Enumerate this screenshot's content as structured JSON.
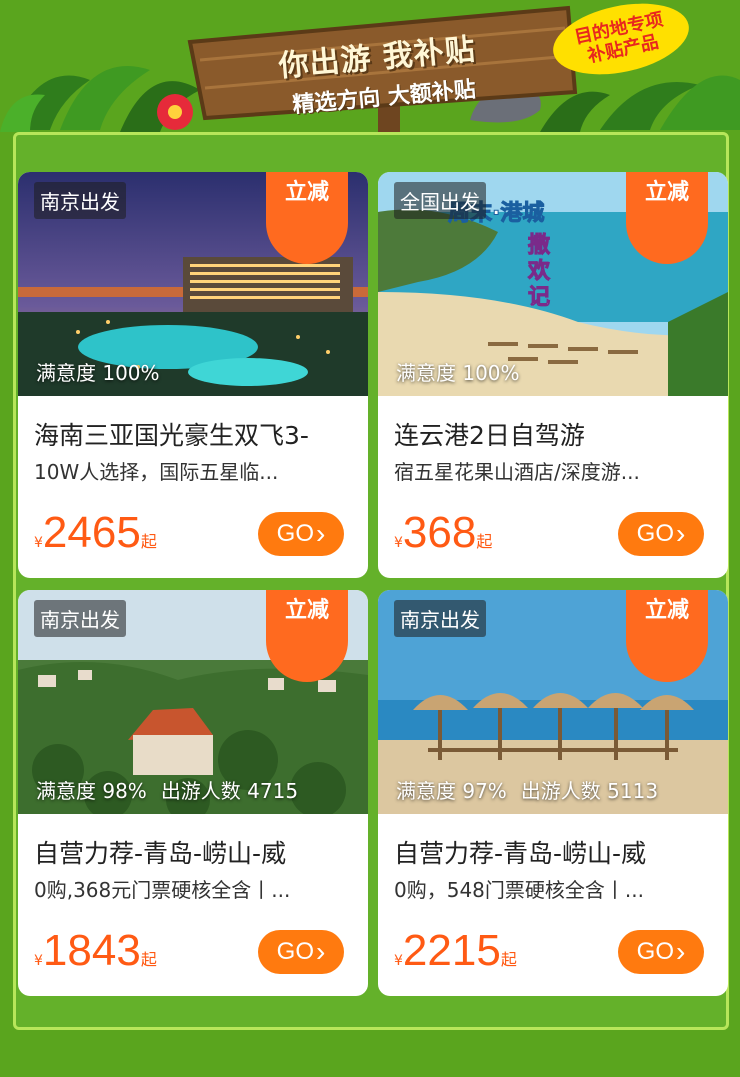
{
  "header": {
    "sign_line1": "你出游 我补贴",
    "sign_line2": "精选方向 大额补贴",
    "badge_line1": "目的地专项",
    "badge_line2": "补贴产品"
  },
  "cards": [
    {
      "origin": "南京出发",
      "discount": "立减",
      "satisfaction": "满意度 100%",
      "travelers": "",
      "title": "海南三亚国光豪生双飞3-",
      "subtitle": "10W人选择，国际五星临...",
      "currency": "¥",
      "price": "2465",
      "price_suffix": "起",
      "button": "GO"
    },
    {
      "origin": "全国出发",
      "discount": "立减",
      "satisfaction": "满意度 100%",
      "travelers": "",
      "title": "连云港2日自驾游",
      "subtitle": "宿五星花果山酒店/深度游...",
      "currency": "¥",
      "price": "368",
      "price_suffix": "起",
      "button": "GO",
      "image_text": [
        "周末·港城",
        "撒欢记"
      ]
    },
    {
      "origin": "南京出发",
      "discount": "立减",
      "satisfaction": "满意度 98%",
      "travelers": "出游人数 4715",
      "title": "自营力荐-青岛-崂山-威",
      "subtitle": "0购,368元门票硬核全含丨...",
      "currency": "¥",
      "price": "1843",
      "price_suffix": "起",
      "button": "GO"
    },
    {
      "origin": "南京出发",
      "discount": "立减",
      "satisfaction": "满意度 97%",
      "travelers": "出游人数 5113",
      "title": "自营力荐-青岛-崂山-威",
      "subtitle": "0购，548门票硬核全含丨...",
      "currency": "¥",
      "price": "2215",
      "price_suffix": "起",
      "button": "GO"
    }
  ],
  "colors": {
    "page_bg": "#5aa51e",
    "accent_orange": "#ff6a1f",
    "price_orange": "#ff5a14",
    "badge_yellow": "#ffe000"
  }
}
